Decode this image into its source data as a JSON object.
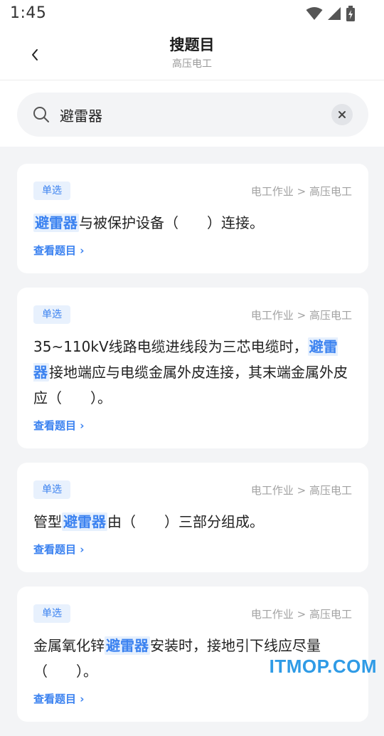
{
  "status": {
    "time": "1:45"
  },
  "header": {
    "title": "搜题目",
    "subtitle": "高压电工"
  },
  "search": {
    "value": "避雷器"
  },
  "results": [
    {
      "tag": "单选",
      "category": "电工作业 > 高压电工",
      "before": "",
      "keyword": "避雷器",
      "after": "与被保护设备（　　）连接。",
      "link": "查看题目 ›"
    },
    {
      "tag": "单选",
      "category": "电工作业 > 高压电工",
      "before": "35~110kV线路电缆进线段为三芯电缆时，",
      "keyword": "避雷器",
      "after": "接地端应与电缆金属外皮连接，其末端金属外皮应（　　）。",
      "link": "查看题目 ›"
    },
    {
      "tag": "单选",
      "category": "电工作业 > 高压电工",
      "before": "管型",
      "keyword": "避雷器",
      "after": "由（　　）三部分组成。",
      "link": "查看题目 ›"
    },
    {
      "tag": "单选",
      "category": "电工作业 > 高压电工",
      "before": "金属氧化锌",
      "keyword": "避雷器",
      "after": "安装时，接地引下线应尽量（　　）。",
      "link": "查看题目 ›"
    }
  ],
  "watermark": "ITMOP.COM",
  "colors": {
    "accent": "#3b82f0",
    "highlight_bg": "#e6f0fd",
    "page_bg": "#f3f4f6"
  },
  "icons": [
    "wifi-icon",
    "signal-icon",
    "battery-icon",
    "back-chevron-icon",
    "search-icon",
    "clear-icon"
  ]
}
